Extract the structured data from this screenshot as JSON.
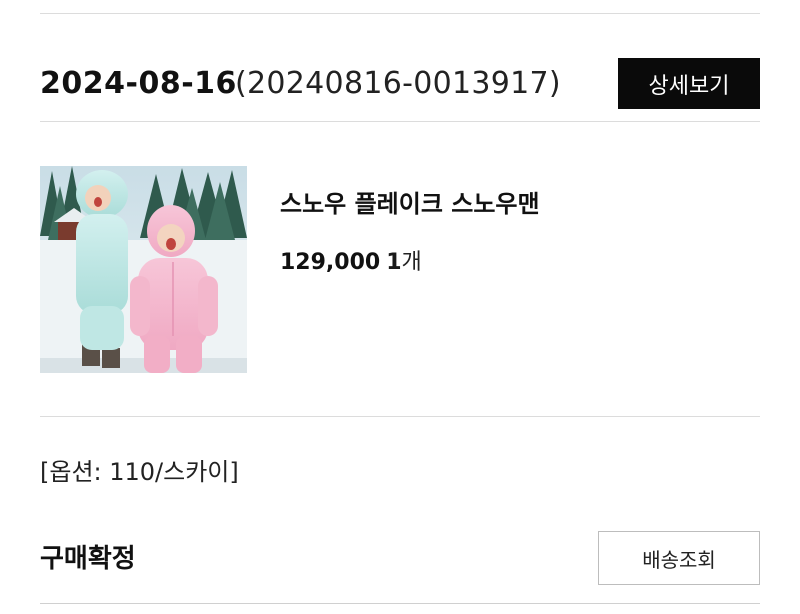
{
  "order": {
    "date": "2024-08-16",
    "number": "(20240816-0013917)",
    "detail_button": "상세보기"
  },
  "product": {
    "name": "스노우 플레이크 스노우맨",
    "price": "129,000",
    "quantity": "1",
    "quantity_unit": "개",
    "image_icon": "product-photo-kids-snowsuit"
  },
  "option": {
    "text": "[옵션: 110/스카이]"
  },
  "status": {
    "label": "구매확정",
    "tracking_button": "배송조회"
  },
  "colors": {
    "detail_button_bg": "#0a0a0a",
    "divider": "#dcdcdc"
  }
}
